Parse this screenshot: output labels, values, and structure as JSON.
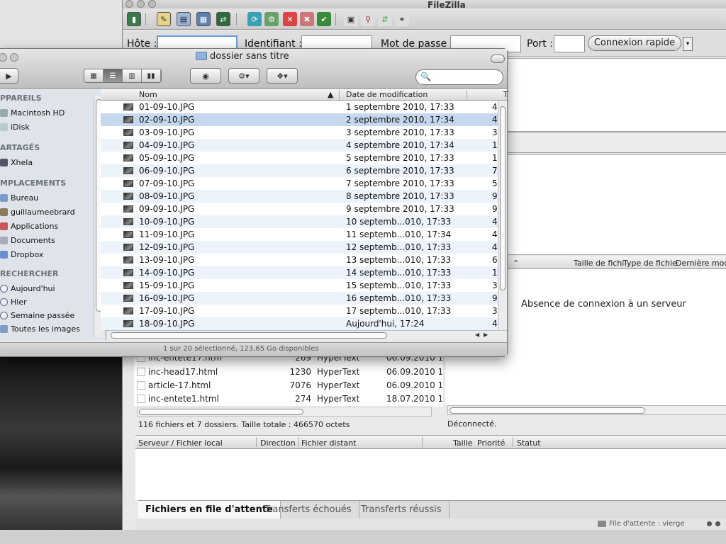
{
  "filezilla": {
    "title": "FileZilla",
    "quickconnect": {
      "host_label": "Hôte :",
      "user_label": "Identifiant :",
      "pass_label": "Mot de passe :",
      "port_label": "Port :",
      "host_value": "",
      "user_value": "",
      "pass_value": "",
      "port_value": "",
      "connect_button": "Connexion rapide"
    },
    "remote": {
      "columns": [
        "Taille de fichi",
        "Type de fichie",
        "Dernière modif"
      ],
      "message": "Absence de connexion à un serveur",
      "status": "Déconnecté."
    },
    "local": {
      "rows": [
        {
          "name": "inc-entete17.htm",
          "size": "269",
          "type": "HyperText",
          "date": "06.09.2010 1"
        },
        {
          "name": "inc-head17.html",
          "size": "1230",
          "type": "HyperText",
          "date": "06.09.2010 1"
        },
        {
          "name": "article-17.html",
          "size": "7076",
          "type": "HyperText",
          "date": "06.09.2010 1"
        },
        {
          "name": "inc-entete1.html",
          "size": "274",
          "type": "HyperText",
          "date": "18.07.2010 1"
        }
      ],
      "status": "116 fichiers et 7 dossiers. Taille totale : 466570 octets"
    },
    "queue": {
      "columns": [
        "Serveur / Fichier local",
        "Direction",
        "Fichier distant",
        "Taille",
        "Priorité",
        "Statut"
      ],
      "tabs": [
        "Fichiers en file d'attente",
        "Transferts échoués",
        "Transferts réussis"
      ],
      "status": "File d'attente : vierge"
    }
  },
  "finder": {
    "title": "dossier sans titre",
    "sidebar": {
      "sections": [
        {
          "header": "PPAREILS",
          "items": [
            {
              "label": "Macintosh HD",
              "icon": "harddisk-icon"
            },
            {
              "label": "iDisk",
              "icon": "idisk-icon"
            }
          ]
        },
        {
          "header": "ARTAGÉS",
          "items": [
            {
              "label": "Xhela",
              "icon": "computer-icon"
            }
          ]
        },
        {
          "header": "MPLACEMENTS",
          "items": [
            {
              "label": "Bureau",
              "icon": "desktop-icon"
            },
            {
              "label": "guillaumeebrard",
              "icon": "home-icon"
            },
            {
              "label": "Applications",
              "icon": "applications-icon"
            },
            {
              "label": "Documents",
              "icon": "documents-icon"
            },
            {
              "label": "Dropbox",
              "icon": "dropbox-folder-icon"
            }
          ]
        },
        {
          "header": "RECHERCHER",
          "items": [
            {
              "label": "Aujourd'hui",
              "icon": "clock-icon"
            },
            {
              "label": "Hier",
              "icon": "clock-icon"
            },
            {
              "label": "Semaine passée",
              "icon": "clock-icon"
            },
            {
              "label": "Toutes les images",
              "icon": "images-folder-icon"
            }
          ]
        }
      ]
    },
    "columns": {
      "name": "Nom",
      "date": "Date de modification",
      "size": "T"
    },
    "files": [
      {
        "name": "01-09-10.JPG",
        "date": "1 septembre 2010, 17:33",
        "size": "4"
      },
      {
        "name": "02-09-10.JPG",
        "date": "2 septembre 2010, 17:34",
        "size": "4"
      },
      {
        "name": "03-09-10.JPG",
        "date": "3 septembre 2010, 17:33",
        "size": "3"
      },
      {
        "name": "04-09-10.JPG",
        "date": "4 septembre 2010, 17:34",
        "size": "1"
      },
      {
        "name": "05-09-10.JPG",
        "date": "5 septembre 2010, 17:33",
        "size": "1"
      },
      {
        "name": "06-09-10.JPG",
        "date": "6 septembre 2010, 17:33",
        "size": "7"
      },
      {
        "name": "07-09-10.JPG",
        "date": "7 septembre 2010, 17:33",
        "size": "5"
      },
      {
        "name": "08-09-10.JPG",
        "date": "8 septembre 2010, 17:33",
        "size": "9"
      },
      {
        "name": "09-09-10.JPG",
        "date": "9 septembre 2010, 17:33",
        "size": "9"
      },
      {
        "name": "10-09-10.JPG",
        "date": "10 septemb...010, 17:33",
        "size": "4"
      },
      {
        "name": "11-09-10.JPG",
        "date": "11 septemb...010, 17:34",
        "size": "4"
      },
      {
        "name": "12-09-10.JPG",
        "date": "12 septemb...010, 17:33",
        "size": "4"
      },
      {
        "name": "13-09-10.JPG",
        "date": "13 septemb...010, 17:33",
        "size": "6"
      },
      {
        "name": "14-09-10.JPG",
        "date": "14 septemb...010, 17:33",
        "size": "1"
      },
      {
        "name": "15-09-10.JPG",
        "date": "15 septemb...010, 17:33",
        "size": "3"
      },
      {
        "name": "16-09-10.JPG",
        "date": "16 septemb...010, 17:33",
        "size": "9"
      },
      {
        "name": "17-09-10.JPG",
        "date": "17 septemb...010, 17:33",
        "size": "3"
      },
      {
        "name": "18-09-10.JPG",
        "date": "Aujourd'hui, 17:24",
        "size": "4"
      }
    ],
    "selected_index": 1,
    "status": "1 sur 20 sélectionné, 123,65 Go disponibles"
  }
}
